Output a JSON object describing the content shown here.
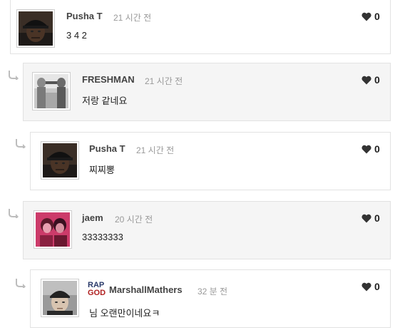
{
  "comments": [
    {
      "author": "Pusha T",
      "time": "21 시간 전",
      "text": "3 4 2",
      "likes": "0",
      "avatar_icon": "person-cap-avatar"
    },
    {
      "author": "FRESHMAN",
      "time": "21 시간 전",
      "text": "저랑 같네요",
      "likes": "0",
      "avatar_icon": "two-people-avatar"
    },
    {
      "author": "Pusha T",
      "time": "21 시간 전",
      "text": "찌찌뽕",
      "likes": "0",
      "avatar_icon": "person-cap-avatar"
    },
    {
      "author": "jaem",
      "time": "20 시간 전",
      "text": "33333333",
      "likes": "0",
      "avatar_icon": "pink-duo-avatar"
    },
    {
      "author": "MarshallMathers",
      "badge_top": "RAP",
      "badge_bottom": "GOD",
      "time": "32 분 전",
      "text": "님 오랜만이네요ㅋ",
      "likes": "0",
      "avatar_icon": "person-beanie-avatar"
    }
  ],
  "colors": {
    "reply_bg": "#f5f5f5",
    "border": "#e2e2e2",
    "rap_color": "#2a3a6a",
    "god_color": "#b02020"
  }
}
